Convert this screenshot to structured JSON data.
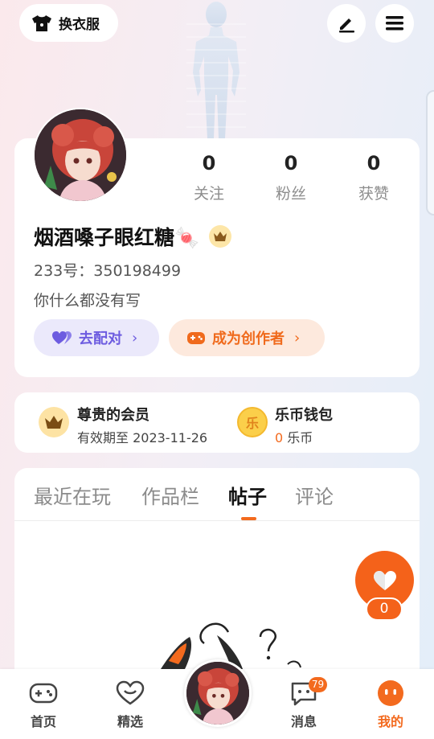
{
  "topbar": {
    "wardrobe_label": "换衣服",
    "icons": [
      "shirt-icon",
      "pen-icon",
      "menu-icon"
    ]
  },
  "profile": {
    "stats": [
      {
        "value": "0",
        "label": "关注"
      },
      {
        "value": "0",
        "label": "粉丝"
      },
      {
        "value": "0",
        "label": "获赞"
      }
    ],
    "username": "烟酒嗓子眼红糖🍬",
    "uid": "233号：350198499",
    "bio": "你什么都没有写",
    "pair_button": "去配对",
    "creator_button": "成为创作者",
    "chevron": "›"
  },
  "membership": {
    "vip_title": "尊贵的会员",
    "vip_expiry": "有效期至 2023-11-26",
    "wallet_title": "乐币钱包",
    "wallet_amount": "0",
    "wallet_unit": " 乐币",
    "coin_glyph": "乐"
  },
  "tabs": {
    "items": [
      "最近在玩",
      "作品栏",
      "帖子",
      "评论"
    ],
    "active": "帖子"
  },
  "like": {
    "count": "0"
  },
  "bottom_nav": {
    "home": "首页",
    "featured": "精选",
    "messages": "消息",
    "messages_badge": "79",
    "me": "我的"
  },
  "colors": {
    "accent": "#f36a1e",
    "pair_purple": "#6d5ce0",
    "vip_gold": "#fde3a4"
  }
}
